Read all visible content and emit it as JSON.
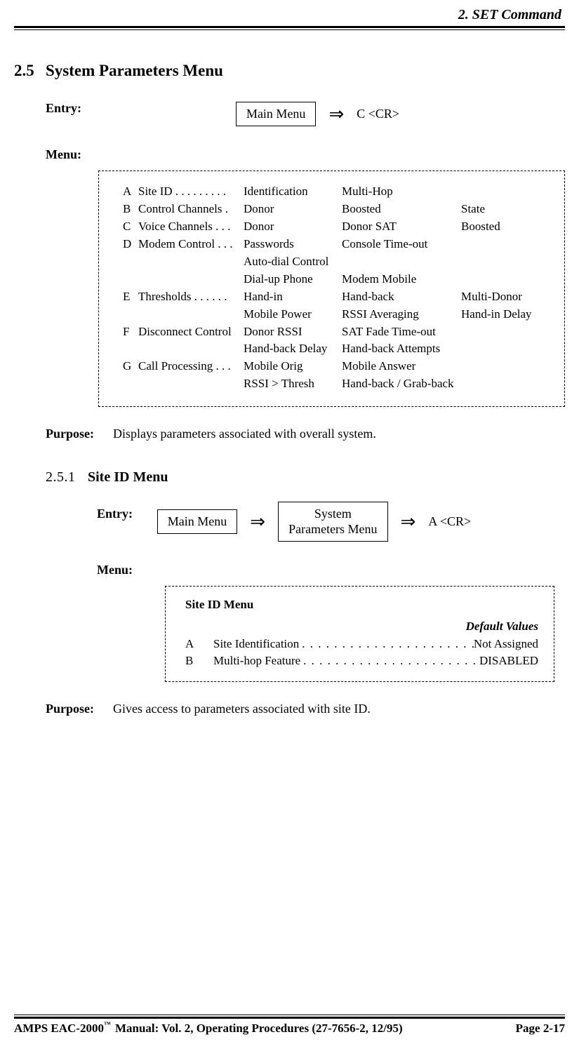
{
  "header": {
    "chapter": "2.  SET Command"
  },
  "section25": {
    "num": "2.5",
    "title": "System Parameters Menu",
    "entry_label": "Entry:",
    "entry_box": "Main Menu",
    "entry_cmd": "C <CR>",
    "menu_label": "Menu:",
    "rows": [
      {
        "k": "A",
        "n": "Site ID . . . . . . . . .",
        "c1": "Identification",
        "c2": "Multi-Hop",
        "c3": ""
      },
      {
        "k": "B",
        "n": "Control Channels   .",
        "c1": "Donor",
        "c2": "Boosted",
        "c3": "State"
      },
      {
        "k": "C",
        "n": "Voice Channels . . .",
        "c1": "Donor",
        "c2": "Donor SAT",
        "c3": "Boosted"
      },
      {
        "k": "D",
        "n": "Modem Control . . .",
        "c1": "Passwords",
        "c2": "Console Time-out",
        "c3": ""
      },
      {
        "k": "",
        "n": "",
        "c1": "Auto-dial Control",
        "c2": "",
        "c3": ""
      },
      {
        "k": "",
        "n": "",
        "c1": "Dial-up Phone",
        "c2": "Modem Mobile",
        "c3": ""
      },
      {
        "k": "E",
        "n": "Thresholds  . . . . . .",
        "c1": "Hand-in",
        "c2": "Hand-back",
        "c3": "Multi-Donor"
      },
      {
        "k": "",
        "n": "",
        "c1": "Mobile Power",
        "c2": "RSSI Averaging",
        "c3": "Hand-in Delay"
      },
      {
        "k": "F",
        "n": "Disconnect Control",
        "c1": "Donor RSSI",
        "c2": "SAT Fade Time-out",
        "c3": ""
      },
      {
        "k": "",
        "n": "",
        "c1": "Hand-back Delay",
        "c2": "Hand-back Attempts",
        "c3": ""
      },
      {
        "k": "G",
        "n": "Call Processing  . . .",
        "c1": "Mobile Orig",
        "c2": "Mobile Answer",
        "c3": ""
      },
      {
        "k": "",
        "n": "",
        "c1": "RSSI > Thresh",
        "c2": "Hand-back / Grab-back",
        "c3": ""
      }
    ],
    "purpose_label": "Purpose:",
    "purpose_text": "Displays parameters associated with overall system."
  },
  "section251": {
    "num": "2.5.1",
    "title": "Site ID Menu",
    "entry_label": "Entry:",
    "entry_box1": "Main Menu",
    "entry_box2": "System\nParameters Menu",
    "entry_cmd": "A <CR>",
    "menu_label": "Menu:",
    "box_title": "Site ID Menu",
    "default_values": "Default Values",
    "items": [
      {
        "k": "A",
        "name": "Site Identification",
        "val": "Not Assigned"
      },
      {
        "k": "B",
        "name": "Multi-hop Feature",
        "val": "DISABLED"
      }
    ],
    "purpose_label": "Purpose:",
    "purpose_text": "Gives access to parameters associated with site ID."
  },
  "footer": {
    "product": "AMPS EAC-2000",
    "tm": "™",
    "manual": " Manual:  Vol. 2, Operating Procedures (27-7656-2, 12/95)",
    "page": "Page 2-17"
  }
}
